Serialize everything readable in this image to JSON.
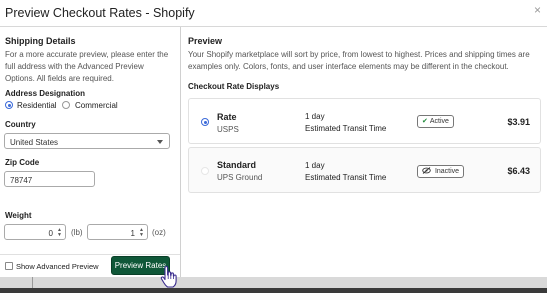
{
  "window": {
    "title": "Preview Checkout Rates - Shopify",
    "close_label": "×"
  },
  "left": {
    "heading": "Shipping Details",
    "intro": "For a more accurate preview, please enter the full address with the Advanced Preview Options. All fields are required.",
    "address_designation": {
      "label": "Address Designation",
      "options": [
        "Residential",
        "Commercial"
      ],
      "selected": "Residential"
    },
    "country": {
      "label": "Country",
      "value": "United States"
    },
    "zip": {
      "label": "Zip Code",
      "value": "78747"
    },
    "weight": {
      "label": "Weight",
      "lb": "0",
      "lb_unit": "(lb)",
      "oz": "1",
      "oz_unit": "(oz)"
    },
    "show_advanced": "Show Advanced Preview",
    "preview_button": "Preview Rates"
  },
  "right": {
    "heading": "Preview",
    "description": "Your Shopify marketplace will sort by price, from lowest to highest. Prices and shipping times are examples only. Colors, fonts, and user interface elements may be different in the checkout.",
    "subheading": "Checkout Rate Displays",
    "rates": [
      {
        "name": "Rate",
        "carrier": "USPS",
        "days": "1 day",
        "transit": "Estimated Transit Time",
        "status": "Active",
        "status_icon": "check-icon",
        "price": "$3.91",
        "selected": true
      },
      {
        "name": "Standard",
        "carrier": "UPS Ground",
        "days": "1 day",
        "transit": "Estimated Transit Time",
        "status": "Inactive",
        "status_icon": "eye-slash-icon",
        "price": "$6.43",
        "selected": false
      }
    ]
  },
  "colors": {
    "primary_button": "#0f5738",
    "radio_selected": "#3b6ad9",
    "active_check": "#1f8a3a"
  }
}
